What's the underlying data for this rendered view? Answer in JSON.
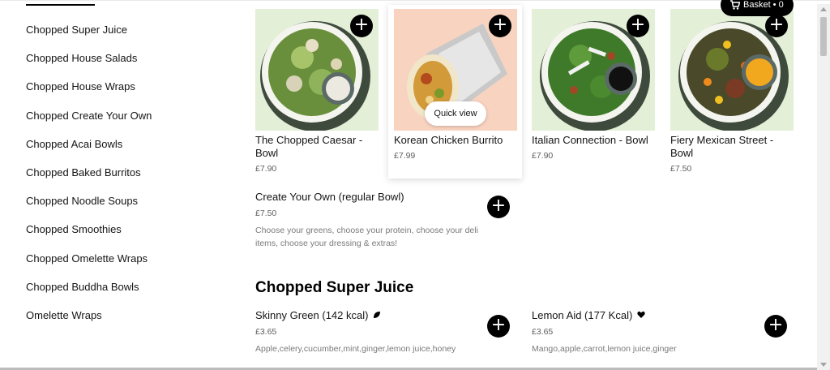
{
  "sidebar": {
    "items": [
      {
        "label": "Chopped Super Juice"
      },
      {
        "label": "Chopped House Salads"
      },
      {
        "label": "Chopped House Wraps"
      },
      {
        "label": "Chopped Create Your Own"
      },
      {
        "label": "Chopped Acai Bowls"
      },
      {
        "label": "Chopped Baked Burritos"
      },
      {
        "label": "Chopped Noodle Soups"
      },
      {
        "label": "Chopped Smoothies"
      },
      {
        "label": "Chopped Omelette Wraps"
      },
      {
        "label": "Chopped Buddha Bowls"
      },
      {
        "label": "Omelette Wraps"
      }
    ]
  },
  "basket": {
    "label": "Basket • 0"
  },
  "cards": [
    {
      "title": "The Chopped Caesar - Bowl",
      "price": "£7.90",
      "bg": "#e4efd8"
    },
    {
      "title": "Korean Chicken Burrito",
      "price": "£7.99",
      "bg": "#f8d3c0"
    },
    {
      "title": "Italian Connection - Bowl",
      "price": "£7.90",
      "bg": "#e4efd8"
    },
    {
      "title": "Fiery Mexican Street - Bowl",
      "price": "£7.50",
      "bg": "#e4efd8"
    }
  ],
  "quick_view": {
    "label": "Quick view"
  },
  "create_own": {
    "title": "Create Your Own (regular Bowl)",
    "price": "£7.50",
    "desc": "Choose your greens, choose your protein, choose your deli items, choose your dressing & extras!"
  },
  "section": {
    "title": "Chopped Super Juice"
  },
  "juices": [
    {
      "title": "Skinny Green (142 kcal)",
      "price": "£3.65",
      "desc": "Apple,celery,cucumber,mint,ginger,lemon juice,honey",
      "badge": "leaf-icon"
    },
    {
      "title": "Lemon Aid (177 Kcal)",
      "price": "£3.65",
      "desc": "Mango,apple,carrot,lemon juice,ginger",
      "badge": "heart-icon"
    }
  ],
  "plus_symbol": "+"
}
